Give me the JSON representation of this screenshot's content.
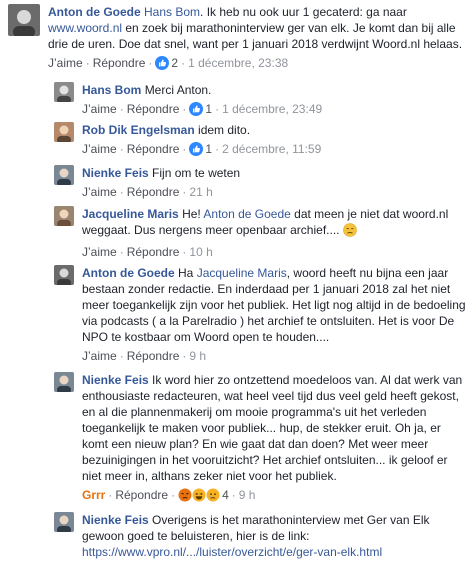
{
  "actions": {
    "like": "J’aime",
    "reply": "Répondre",
    "sep": "·"
  },
  "colors": {
    "link": "#365899",
    "meta": "#90949c",
    "like_blue": "#2d88ff",
    "grrr": "#e9710f"
  },
  "comments": [
    {
      "author": "Anton de Goede",
      "mention": "Hans Bom",
      "text1": ". Ik heb nu ook uur 1 gecaterd: ga naar ",
      "link": "www.woord.nl",
      "text2": " en zoek bij marathoninterview ger van elk. Je komt dan bij alle drie de uren. Doe dat snel, want per 1 januari 2018 verdwijnt Woord.nl helaas.",
      "like_label": "J’aime",
      "reply_label": "Répondre",
      "reaction_count": "2",
      "time": "1 décembre, 23:38",
      "reaction_icon": "thumbs-up-icon"
    },
    {
      "author": "Hans Bom",
      "text": "Merci Anton.",
      "like_label": "J’aime",
      "reply_label": "Répondre",
      "reaction_count": "1",
      "time": "1 décembre, 23:49",
      "reaction_icon": "thumbs-up-icon"
    },
    {
      "author": "Rob Dik Engelsman",
      "text": "idem dito.",
      "like_label": "J’aime",
      "reply_label": "Répondre",
      "reaction_count": "1",
      "time": "2 décembre, 11:59",
      "reaction_icon": "thumbs-up-icon"
    },
    {
      "author": "Nienke Feis",
      "text": "Fijn om te weten",
      "like_label": "J’aime",
      "reply_label": "Répondre",
      "time": "21 h"
    },
    {
      "author": "Jacqueline Maris",
      "text1": "He! ",
      "mention": "Anton de Goede",
      "text2": " dat meen je niet dat woord.nl weggaat. Dus nergens meer openbaar archief....",
      "emoji": "unamused-face-icon",
      "like_label": "J’aime",
      "reply_label": "Répondre",
      "time": "10 h"
    },
    {
      "author": "Anton de Goede",
      "text1": "Ha ",
      "mention": "Jacqueline Maris",
      "text2": ", woord heeft nu bijna een jaar bestaan zonder redactie. En inderdaad per 1 januari 2018 zal het niet meer toegankelijk zijn voor het publiek. Het ligt nog altijd in de bedoeling via podcasts ( a la Parelradio ) het archief te ontsluiten. Het is voor De NPO te kostbaar om Woord open te houden....",
      "like_label": "J’aime",
      "reply_label": "Répondre",
      "time": "9 h"
    },
    {
      "author": "Nienke Feis",
      "text": "Ik word hier zo ontzettend moedeloos van. Al dat werk van enthousiaste redacteuren, wat heel veel tijd dus veel geld heeft gekost, en al die plannenmakerij om mooie programma's uit het verleden toegankelijk te maken voor publiek... hup, de stekker eruit. Oh ja, er komt een nieuw plan? En wie gaat dat dan doen? Met weer meer bezuinigingen in het vooruitzicht? Het archief ontsluiten... ik geloof er niet meer in, althans zeker niet voor het publiek.",
      "like_label": "Grrr",
      "reply_label": "Répondre",
      "reaction_count": "4",
      "time": "9 h",
      "reaction_icons": [
        "angry-icon",
        "laugh-icon",
        "sad-icon"
      ]
    },
    {
      "author": "Nienke Feis",
      "text": "Overigens is het marathoninterview met Ger van Elk gewoon goed te beluisteren, hier is de link: ",
      "link": "https://www.vpro.nl/.../luister/overzicht/e/ger-van-elk.html"
    }
  ]
}
